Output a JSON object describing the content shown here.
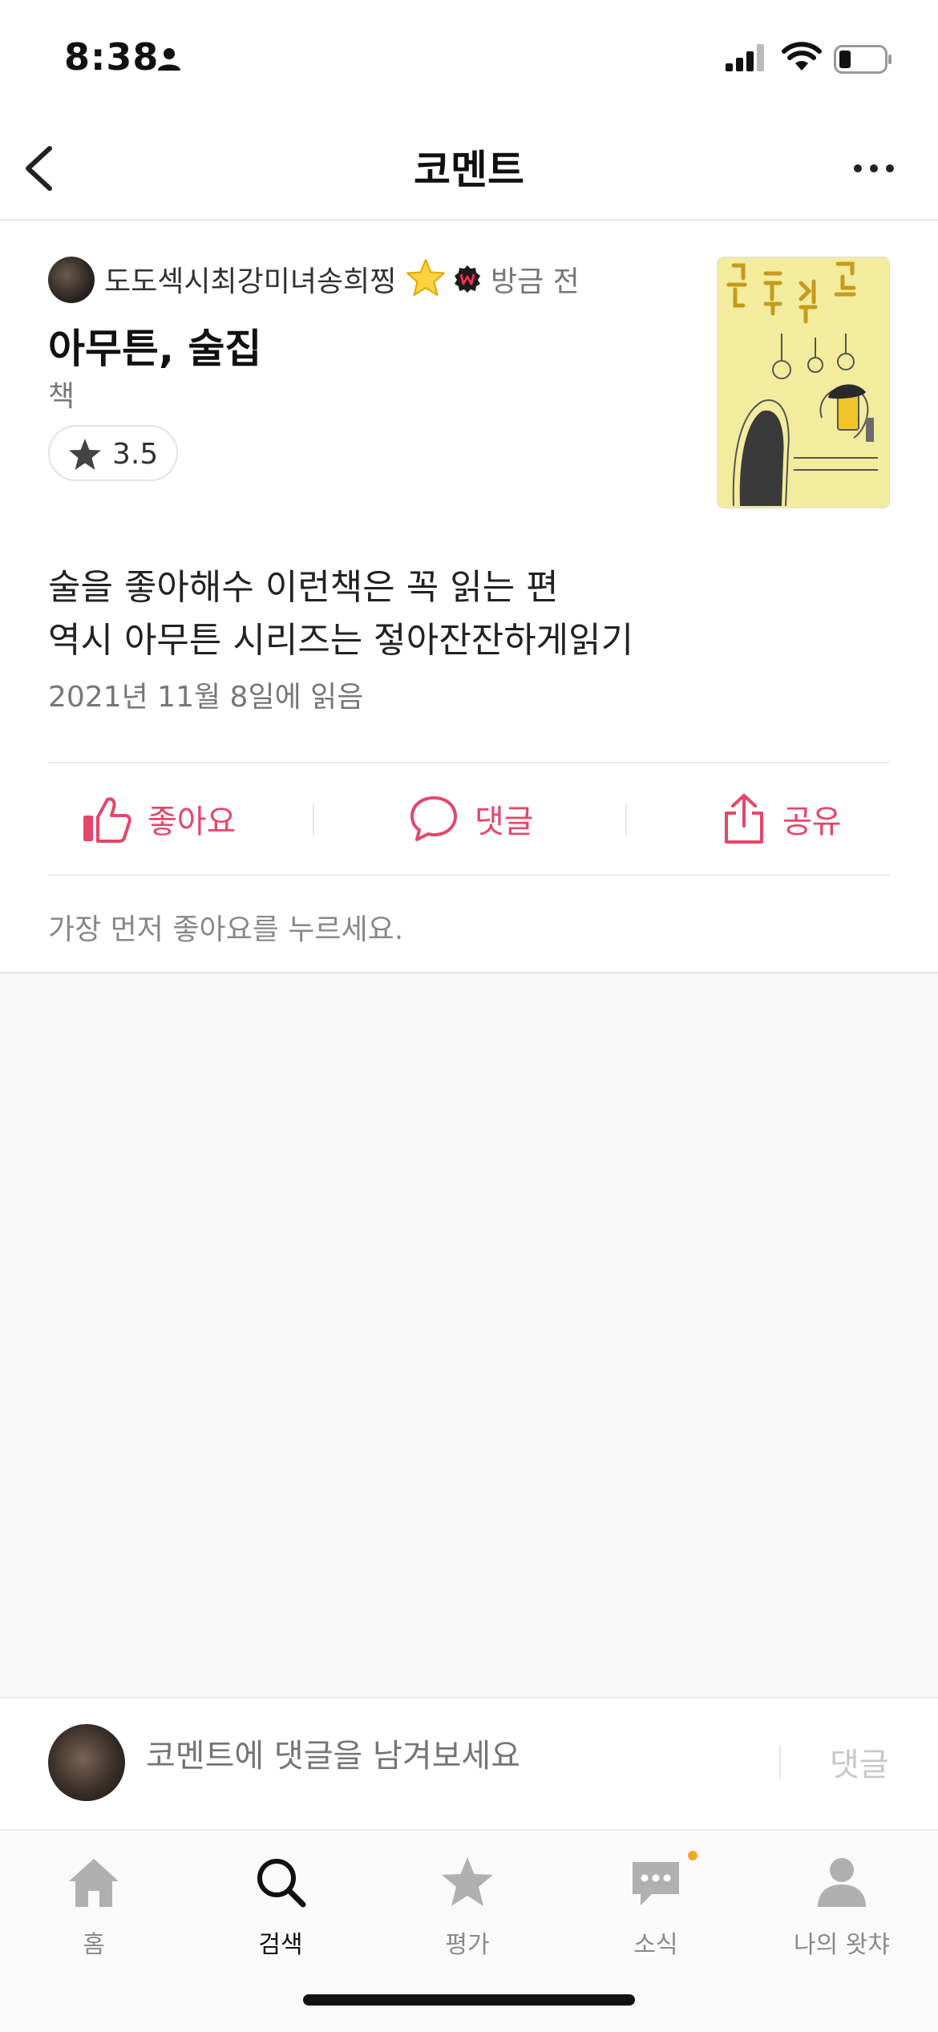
{
  "status_bar": {
    "time": "8:38"
  },
  "nav": {
    "title": "코멘트"
  },
  "comment": {
    "author": "도도섹시최강미녀송희찡",
    "time_ago": "방금 전",
    "book_title": "아무튼, 술집",
    "category": "책",
    "rating": "3.5",
    "body_lines": [
      "술을 좋아해수 이런책은 꼭 읽는 편",
      "역시 아무튼 시리즈는 젛아잔잔하게읽기"
    ],
    "read_date": "2021년 11월 8일에 읽음",
    "actions": {
      "like": "좋아요",
      "comment": "댓글",
      "share": "공유"
    },
    "first_like_hint": "가장 먼저 좋아요를 누르세요."
  },
  "reply": {
    "placeholder": "코멘트에 댓글을 남겨보세요",
    "submit": "댓글"
  },
  "tabs": [
    {
      "label": "홈",
      "icon": "home-icon"
    },
    {
      "label": "검색",
      "icon": "search-icon"
    },
    {
      "label": "평가",
      "icon": "star-icon"
    },
    {
      "label": "소식",
      "icon": "chat-icon"
    },
    {
      "label": "나의 왓챠",
      "icon": "person-icon"
    }
  ],
  "colors": {
    "accent": "#e5466a",
    "gray_text": "#777777",
    "tab_inactive": "#8a8a8a"
  }
}
